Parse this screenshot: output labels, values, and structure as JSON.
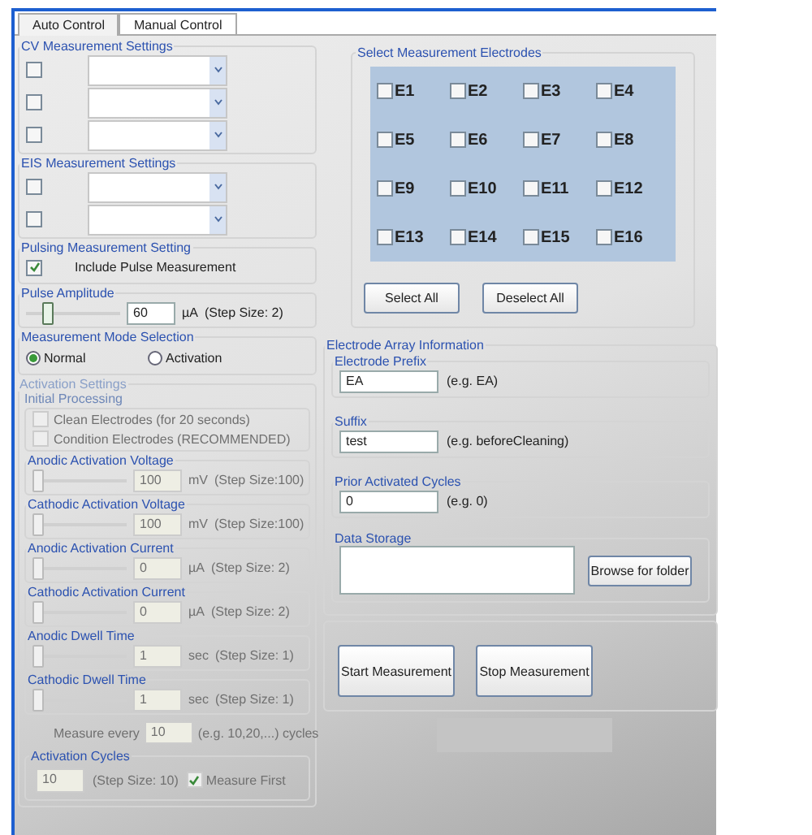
{
  "tabs": [
    {
      "label": "Auto Control",
      "selected": true
    },
    {
      "label": "Manual Control",
      "selected": false
    }
  ],
  "cv": {
    "title": "CV Measurement Settings",
    "rows": [
      {
        "checked": false
      },
      {
        "checked": false
      },
      {
        "checked": false
      }
    ]
  },
  "eis": {
    "title": "EIS Measurement Settings",
    "rows": [
      {
        "checked": false
      },
      {
        "checked": false
      }
    ]
  },
  "pulsing": {
    "title": "Pulsing Measurement Setting",
    "checkbox": {
      "label": "Include Pulse Measurement",
      "checked": true
    }
  },
  "pulse_amplitude": {
    "title": "Pulse Amplitude",
    "level": 0.2,
    "value": "60",
    "unit": "µA",
    "step": "(Step Size: 2)"
  },
  "mode": {
    "title": "Measurement Mode Selection",
    "options": [
      {
        "label": "Normal",
        "selected": true
      },
      {
        "label": "Activation",
        "selected": false
      }
    ]
  },
  "activation": {
    "title": "Activation Settings",
    "disabled": true,
    "initial": {
      "title": "Initial Processing",
      "options": [
        {
          "label": "Clean Electrodes (for 20 seconds)",
          "checked": false
        },
        {
          "label": "Condition Electrodes (RECOMMENDED)",
          "checked": false
        }
      ]
    },
    "sliders": [
      {
        "title": "Anodic Activation Voltage",
        "level": 0,
        "value": "100",
        "unit": "mV",
        "step": "(Step Size:100)"
      },
      {
        "title": "Cathodic Activation Voltage",
        "level": 0,
        "value": "100",
        "unit": "mV",
        "step": "(Step Size:100)"
      },
      {
        "title": "Anodic Activation Current",
        "level": 0,
        "value": "0",
        "unit": "µA",
        "step": "(Step Size: 2)"
      },
      {
        "title": "Cathodic Activation Current",
        "level": 0,
        "value": "0",
        "unit": "µA",
        "step": "(Step Size: 2)"
      },
      {
        "title": "Anodic Dwell Time",
        "level": 0,
        "value": "1",
        "unit": "sec",
        "step": "(Step Size: 1)"
      },
      {
        "title": "Cathodic Dwell Time",
        "level": 0,
        "value": "1",
        "unit": "sec",
        "step": "(Step Size: 1)"
      }
    ],
    "measure_every": {
      "label": "Measure every",
      "value": "10",
      "hint": "(e.g. 10,20,...) cycles"
    },
    "cycles": {
      "title": "Activation Cycles",
      "value": "10",
      "step": "(Step Size: 10)",
      "measure_first": {
        "label": "Measure First",
        "checked": true
      }
    }
  },
  "electrodes": {
    "title": "Select Measurement Electrodes",
    "items": [
      {
        "label": "E1",
        "checked": false
      },
      {
        "label": "E2",
        "checked": false
      },
      {
        "label": "E3",
        "checked": false
      },
      {
        "label": "E4",
        "checked": false
      },
      {
        "label": "E5",
        "checked": false
      },
      {
        "label": "E6",
        "checked": false
      },
      {
        "label": "E7",
        "checked": false
      },
      {
        "label": "E8",
        "checked": false
      },
      {
        "label": "E9",
        "checked": false
      },
      {
        "label": "E10",
        "checked": false
      },
      {
        "label": "E11",
        "checked": false
      },
      {
        "label": "E12",
        "checked": false
      },
      {
        "label": "E13",
        "checked": false
      },
      {
        "label": "E14",
        "checked": false
      },
      {
        "label": "E15",
        "checked": false
      },
      {
        "label": "E16",
        "checked": false
      }
    ],
    "buttons": [
      "Select All",
      "Deselect All"
    ]
  },
  "array_info": {
    "title": "Electrode Array Information",
    "fields": [
      {
        "title": "Electrode Prefix",
        "value": "EA",
        "hint": "(e.g. EA)"
      },
      {
        "title": "Suffix",
        "value": "test",
        "hint": "(e.g. beforeCleaning)"
      },
      {
        "title": "Prior Activated Cycles",
        "value": "0",
        "hint": "(e.g. 0)"
      }
    ],
    "storage": {
      "title": "Data Storage",
      "button": "Browse for folder"
    }
  },
  "actions": [
    "Start Measurement",
    "Stop Measurement"
  ]
}
